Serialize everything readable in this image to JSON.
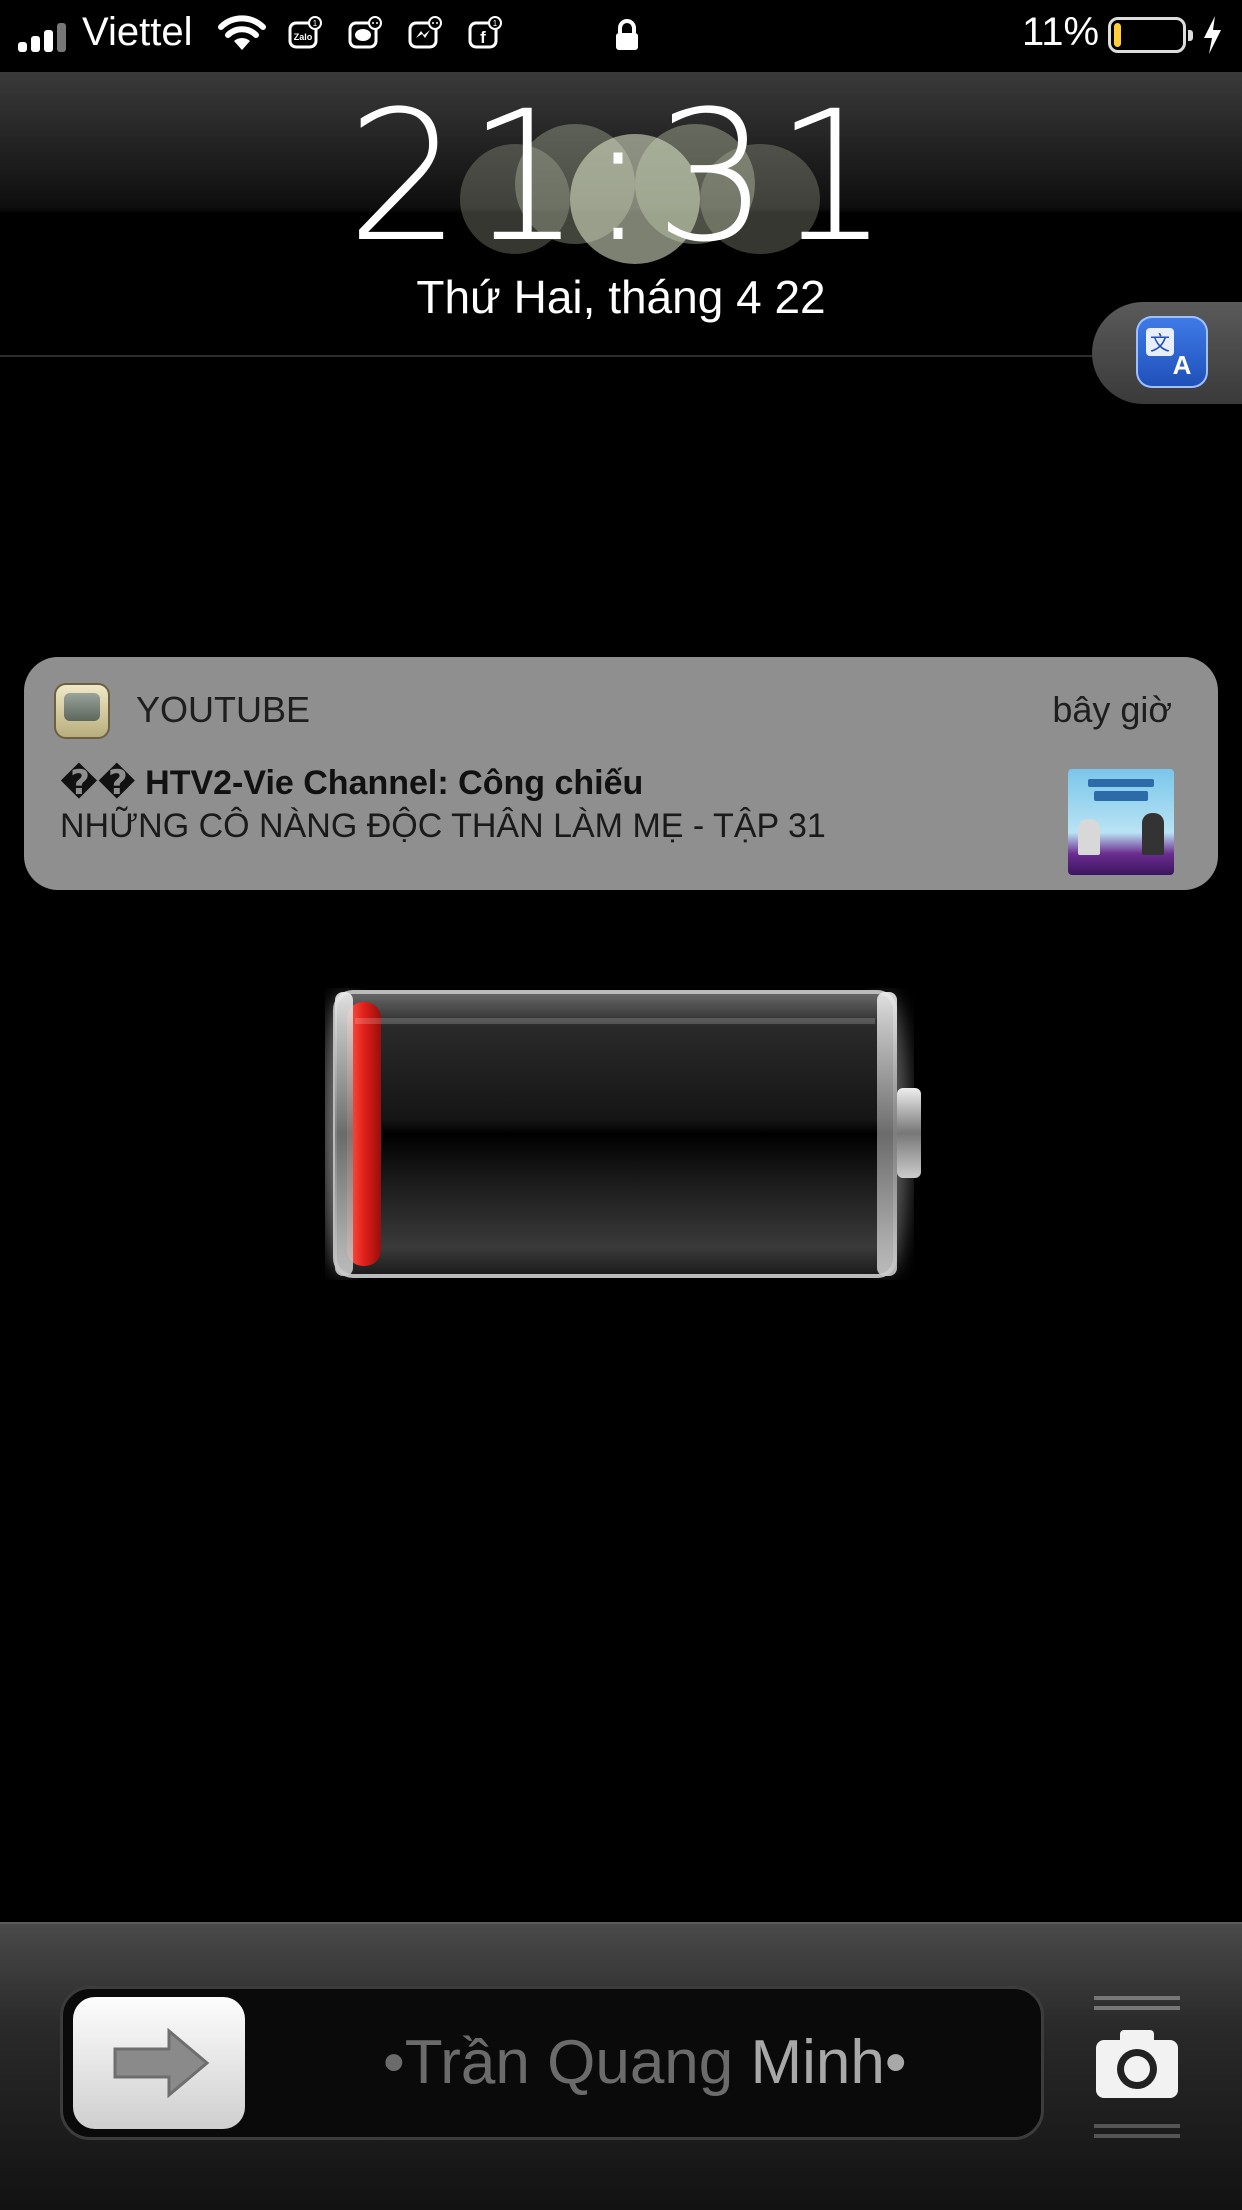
{
  "status_bar": {
    "carrier": "Viettel",
    "battery_percent": "11%",
    "battery_level": 0.11,
    "battery_color": "#ffce3a",
    "notification_icons": [
      "zalo-icon",
      "messages-icon",
      "messenger-icon",
      "facebook-icon"
    ],
    "badge_count": "1"
  },
  "lockscreen": {
    "time": "21:31",
    "date": "Thứ Hai, tháng 4 22"
  },
  "notification": {
    "app_name": "YOUTUBE",
    "time": "bây giờ",
    "title": "�� HTV2-Vie Channel: Công chiếu",
    "body": "NHỮNG CÔ NÀNG ĐỘC THÂN LÀM MẸ - TẬP 31"
  },
  "charging": {
    "level": 0.05,
    "color": "#e0201a"
  },
  "unlock_slider": {
    "label": "•Trần Quang Minh•"
  }
}
